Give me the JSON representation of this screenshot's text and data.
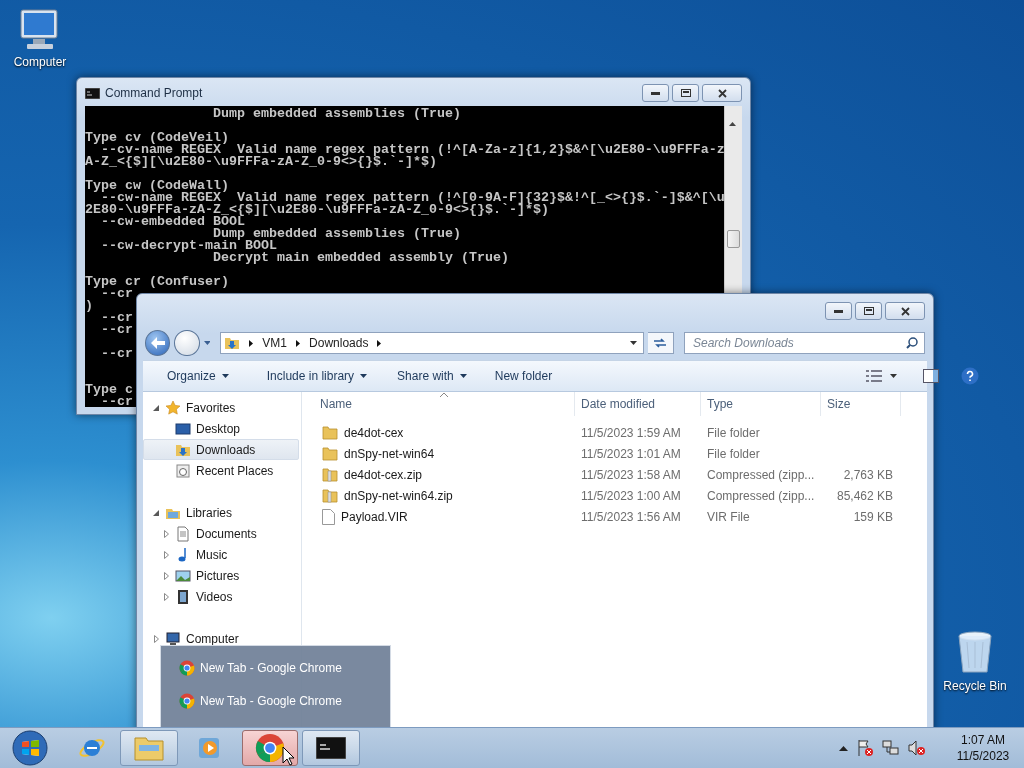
{
  "desktop_icons": [
    {
      "kind": "computer",
      "label": "Computer"
    },
    {
      "kind": "recycle",
      "label": "Recycle Bin"
    }
  ],
  "command_prompt": {
    "title": "Command Prompt",
    "lines": [
      {
        "kind": "text",
        "text": "                Dump embedded assemblies (True)"
      },
      {
        "kind": "blank"
      },
      {
        "kind": "text",
        "text": "Type cv (CodeVeil)"
      },
      {
        "kind": "text",
        "text": "  --cv-name REGEX  Valid name regex pattern (!^[A-Za-z]{1,2}$&^[\\u2E80-\\u9FFFa-z"
      },
      {
        "kind": "text",
        "text": "A-Z_<{$][\\u2E80-\\u9FFFa-zA-Z_0-9<>{}$.`-]*$)"
      },
      {
        "kind": "blank"
      },
      {
        "kind": "text",
        "text": "Type cw (CodeWall)"
      },
      {
        "kind": "text",
        "text": "  --cw-name REGEX  Valid name regex pattern (!^[0-9A-F]{32}$&!^[_<>{}$.`-]$&^[\\u"
      },
      {
        "kind": "text",
        "text": "2E80-\\u9FFFa-zA-Z_<{$][\\u2E80-\\u9FFFa-zA-Z_0-9<>{}$.`-]*$)"
      },
      {
        "kind": "text",
        "text": "  --cw-embedded BOOL"
      },
      {
        "kind": "text",
        "text": "                Dump embedded assemblies (True)"
      },
      {
        "kind": "text",
        "text": "  --cw-decrypt-main BOOL"
      },
      {
        "kind": "text",
        "text": "                Decrypt main embedded assembly (True)"
      },
      {
        "kind": "blank"
      },
      {
        "kind": "text",
        "text": "Type cr (Confuser)"
      },
      {
        "kind": "text",
        "text": "  --cr"
      },
      {
        "kind": "text",
        "text": ")"
      },
      {
        "kind": "text",
        "text": "  --cr"
      },
      {
        "kind": "text",
        "text": "  --cr"
      },
      {
        "kind": "blank"
      },
      {
        "kind": "text",
        "text": "  --cr"
      },
      {
        "kind": "blank"
      },
      {
        "kind": "blank"
      },
      {
        "kind": "text",
        "text": "Type c"
      },
      {
        "kind": "text",
        "text": "  --cr"
      }
    ]
  },
  "explorer": {
    "address": [
      "VM1",
      "Downloads"
    ],
    "search": {
      "placeholder": "Search Downloads"
    },
    "toolbar": [
      {
        "label": "Organize",
        "dropdown": true
      },
      {
        "label": "Include in library",
        "dropdown": true
      },
      {
        "label": "Share with",
        "dropdown": true
      },
      {
        "label": "New folder",
        "dropdown": false
      }
    ],
    "navigation": [
      {
        "kind": "favorites",
        "label": "Favorites",
        "expanded": true,
        "selected": false,
        "children": [
          {
            "kind": "desktop",
            "label": "Desktop",
            "selected": false
          },
          {
            "kind": "downloads",
            "label": "Downloads",
            "selected": true
          },
          {
            "kind": "recent",
            "label": "Recent Places",
            "selected": false
          }
        ]
      },
      {
        "kind": "libraries",
        "label": "Libraries",
        "expanded": true,
        "selected": false,
        "children": [
          {
            "kind": "documents",
            "label": "Documents",
            "expanded": false,
            "selected": false
          },
          {
            "kind": "music",
            "label": "Music",
            "expanded": false,
            "selected": false
          },
          {
            "kind": "pictures",
            "label": "Pictures",
            "expanded": false,
            "selected": false
          },
          {
            "kind": "videos",
            "label": "Videos",
            "expanded": false,
            "selected": false
          }
        ]
      },
      {
        "kind": "computer",
        "label": "Computer",
        "expanded": false,
        "selected": false
      }
    ],
    "columns": [
      "Name",
      "Date modified",
      "Type",
      "Size"
    ],
    "rows": [
      {
        "kind": "folder",
        "name": "de4dot-cex",
        "date": "11/5/2023 1:59 AM",
        "type": "File folder"
      },
      {
        "kind": "folder",
        "name": "dnSpy-net-win64",
        "date": "11/5/2023 1:01 AM",
        "type": "File folder"
      },
      {
        "kind": "zip",
        "name": "de4dot-cex.zip",
        "date": "11/5/2023 1:58 AM",
        "type": "Compressed (zipp...",
        "size": "2,763 KB"
      },
      {
        "kind": "zip",
        "name": "dnSpy-net-win64.zip",
        "date": "11/5/2023 1:00 AM",
        "type": "Compressed (zipp...",
        "size": "85,462 KB"
      },
      {
        "kind": "file",
        "name": "Payload.VIR",
        "date": "11/5/2023 1:56 AM",
        "type": "VIR File",
        "size": "159 KB"
      }
    ]
  },
  "thumbnail_popup": {
    "items": [
      {
        "title": "New Tab - Google Chrome"
      },
      {
        "title": "New Tab - Google Chrome"
      }
    ]
  },
  "taskbar": {
    "items": [
      {
        "kind": "ie",
        "open": false,
        "selected": false
      },
      {
        "kind": "explorer",
        "open": true,
        "selected": false
      },
      {
        "kind": "media",
        "open": false,
        "selected": false
      },
      {
        "kind": "chrome",
        "open": true,
        "selected": true
      },
      {
        "kind": "cmd",
        "open": true,
        "selected": false
      }
    ],
    "clock": {
      "time": "1:07 AM",
      "date": "11/5/2023"
    }
  }
}
